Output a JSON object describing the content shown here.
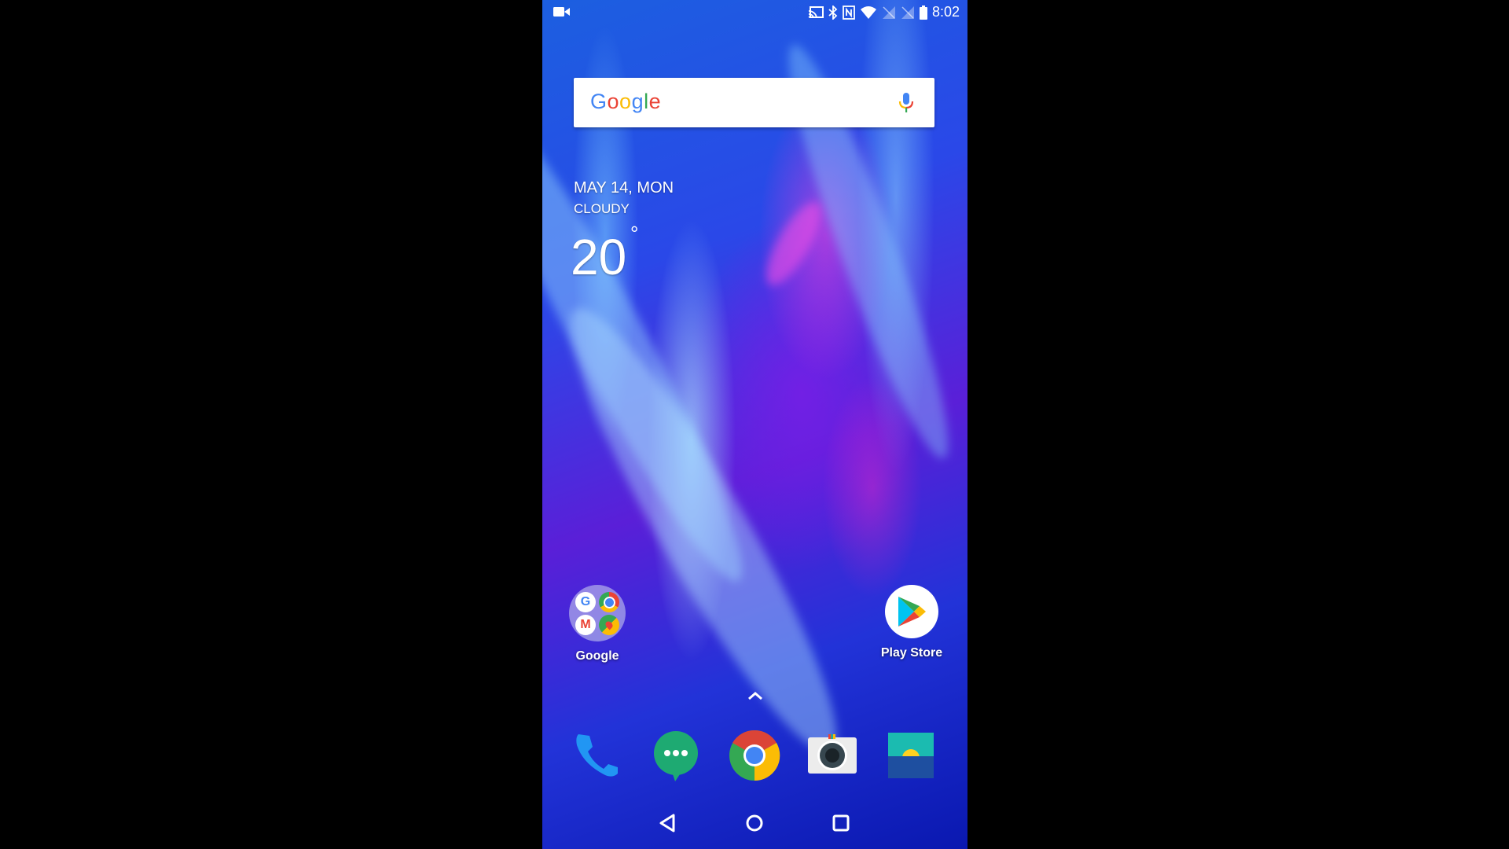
{
  "status_bar": {
    "left_icons": [
      "video-camera-icon"
    ],
    "right_icons": [
      "cast-icon",
      "bluetooth-icon",
      "nfc-icon",
      "wifi-icon",
      "no-sim-icon",
      "no-sim-icon",
      "battery-icon"
    ],
    "time": "8:02"
  },
  "search_widget": {
    "logo_letters": [
      {
        "char": "G",
        "color": "#4285F4"
      },
      {
        "char": "o",
        "color": "#EA4335"
      },
      {
        "char": "o",
        "color": "#FBBC05"
      },
      {
        "char": "g",
        "color": "#4285F4"
      },
      {
        "char": "l",
        "color": "#34A853"
      },
      {
        "char": "e",
        "color": "#EA4335"
      }
    ],
    "mic_icon": "microphone-icon"
  },
  "weather_widget": {
    "date": "MAY 14, MON",
    "condition": "CLOUDY",
    "temperature": "20",
    "degree_symbol": "°"
  },
  "home_apps": [
    {
      "label": "Google",
      "type": "folder",
      "contents": [
        "Google",
        "Chrome",
        "Gmail",
        "Maps"
      ]
    },
    {
      "label": "Play Store",
      "type": "app"
    }
  ],
  "app_drawer_hint": "chevron-up-icon",
  "dock": [
    {
      "name": "Phone",
      "icon": "phone-icon"
    },
    {
      "name": "Messages",
      "icon": "messages-icon"
    },
    {
      "name": "Chrome",
      "icon": "chrome-icon"
    },
    {
      "name": "Camera",
      "icon": "camera-icon"
    },
    {
      "name": "Gallery",
      "icon": "gallery-icon"
    }
  ],
  "nav_bar": [
    "back-button",
    "home-button",
    "recents-button"
  ],
  "colors": {
    "google_blue": "#4285F4",
    "google_red": "#EA4335",
    "google_yellow": "#FBBC05",
    "google_green": "#34A853",
    "wallpaper_blue": "#2a48e8",
    "wallpaper_purple": "#5a1fd8"
  }
}
